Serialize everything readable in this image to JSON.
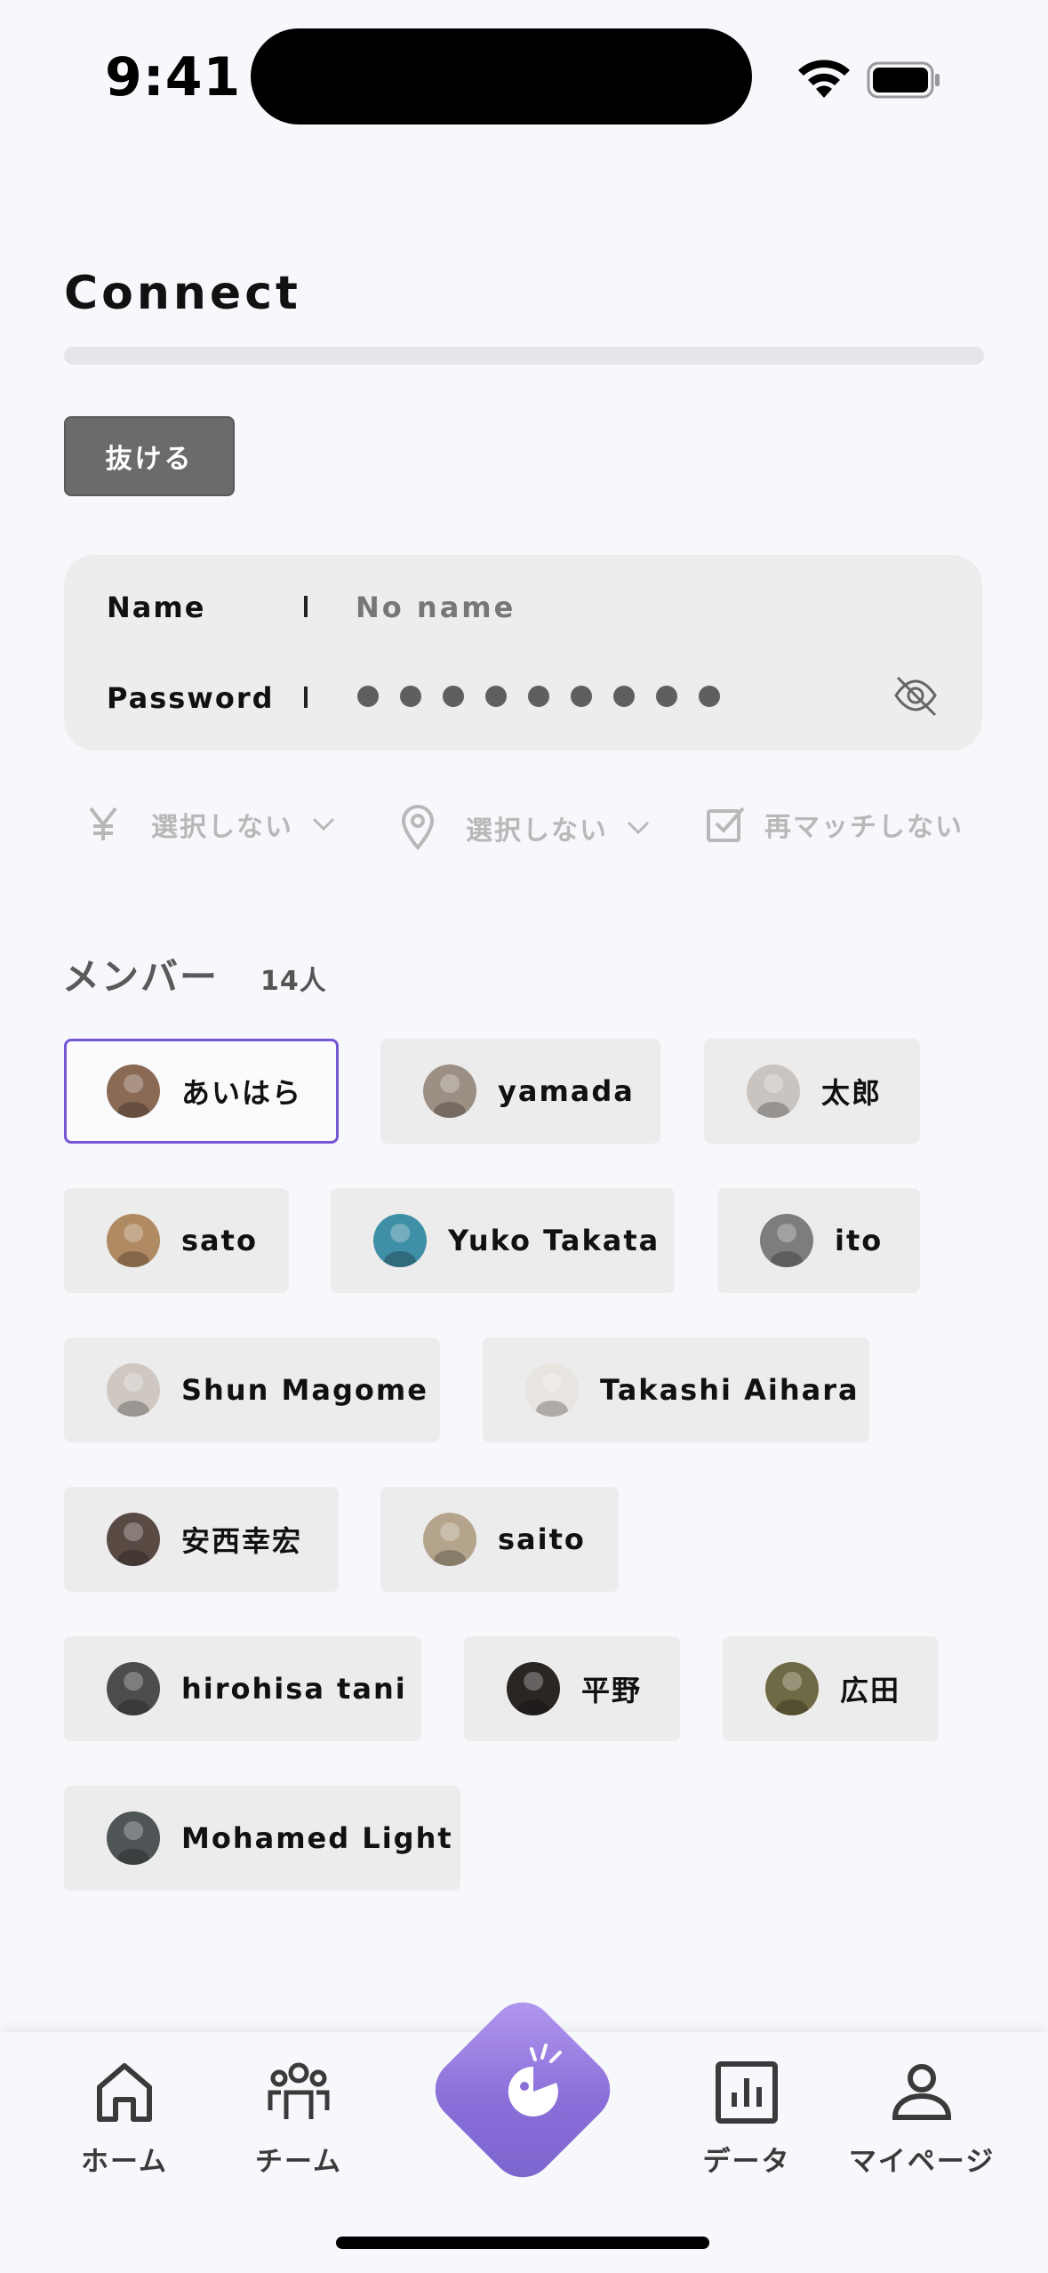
{
  "status_bar": {
    "time": "9:41"
  },
  "header": {
    "title": "Connect"
  },
  "exit_button": {
    "label": "抜ける"
  },
  "credentials": {
    "name_label": "Name",
    "name_value": "No name",
    "password_label": "Password",
    "password_mask_count": 9
  },
  "filters": [
    {
      "icon": "yen-icon",
      "label": "選択しない"
    },
    {
      "icon": "location-pin-icon",
      "label": "選択しない"
    },
    {
      "icon": "checkbox-icon",
      "label": "再マッチしない"
    }
  ],
  "members": {
    "heading": "メンバー",
    "count": "14人",
    "items": [
      {
        "name": "あいはら",
        "selected": true,
        "avatar_color": "#8a6a55"
      },
      {
        "name": "yamada",
        "selected": false,
        "avatar_color": "#9c8f84"
      },
      {
        "name": "太郎",
        "selected": false,
        "avatar_color": "#c9c4c0"
      },
      {
        "name": "sato",
        "selected": false,
        "avatar_color": "#b08a62"
      },
      {
        "name": "Yuko Takata",
        "selected": false,
        "avatar_color": "#3f8fa6"
      },
      {
        "name": "ito",
        "selected": false,
        "avatar_color": "#7d7d7d"
      },
      {
        "name": "Shun Magome",
        "selected": false,
        "avatar_color": "#cfc8c2"
      },
      {
        "name": "Takashi Aihara",
        "selected": false,
        "avatar_color": "#e8e4e0"
      },
      {
        "name": "安西幸宏",
        "selected": false,
        "avatar_color": "#5a4a44"
      },
      {
        "name": "saito",
        "selected": false,
        "avatar_color": "#b5a48c"
      },
      {
        "name": "hirohisa tani",
        "selected": false,
        "avatar_color": "#4c4c4c"
      },
      {
        "name": "平野",
        "selected": false,
        "avatar_color": "#2a2624"
      },
      {
        "name": "広田",
        "selected": false,
        "avatar_color": "#6e6a45"
      },
      {
        "name": "Mohamed Light",
        "selected": false,
        "avatar_color": "#4f5456"
      }
    ]
  },
  "bottom_nav": {
    "items": [
      {
        "label": "ホーム",
        "icon": "home-icon"
      },
      {
        "label": "チーム",
        "icon": "team-icon"
      },
      {
        "label": "",
        "icon": "match-icon"
      },
      {
        "label": "データ",
        "icon": "chart-icon"
      },
      {
        "label": "マイページ",
        "icon": "user-icon"
      }
    ]
  },
  "colors": {
    "accent": "#7456d6",
    "chip_bg": "#ececec",
    "page_bg": "#f7f8fc"
  }
}
